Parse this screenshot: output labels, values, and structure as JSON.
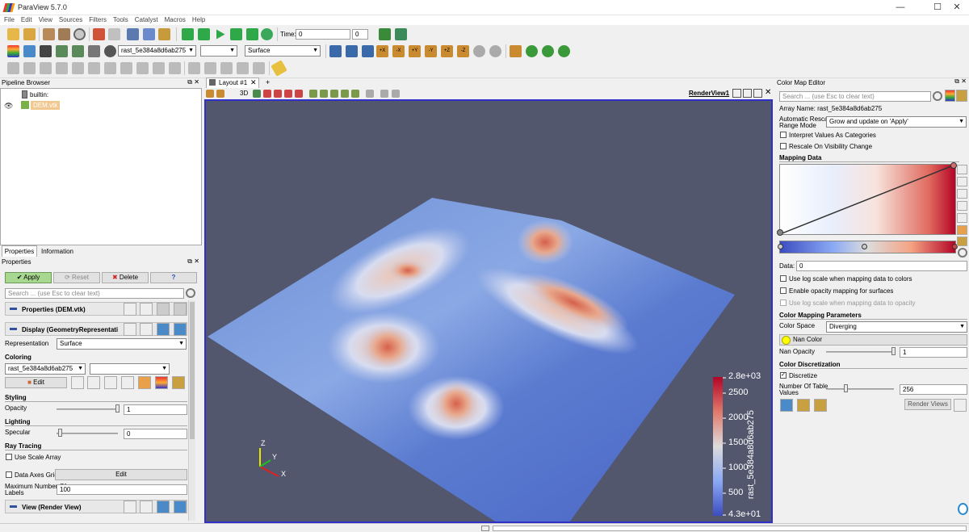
{
  "window": {
    "title": "ParaView 5.7.0",
    "minimize": "—",
    "maximize": "☐",
    "close": "✕"
  },
  "menu": [
    "File",
    "Edit",
    "View",
    "Sources",
    "Filters",
    "Tools",
    "Catalyst",
    "Macros",
    "Help"
  ],
  "toolbar": {
    "time_label": "Time:",
    "time_value": "0",
    "time_step": "0",
    "active_array": "rast_5e384a8d6ab275",
    "representation": "Surface",
    "camera_buttons": [
      "+X",
      "-X",
      "+Y",
      "-Y",
      "+Z",
      "-Z"
    ]
  },
  "pipeline_browser": {
    "title": "Pipeline Browser",
    "items": [
      "builtin:",
      "DEM.vtk"
    ]
  },
  "layout_tabs": {
    "tab": "Layout #1",
    "add": "+",
    "render_view": "RenderView1",
    "mode_3d": "3D"
  },
  "properties": {
    "tabs": [
      "Properties",
      "Information"
    ],
    "title": "Properties",
    "apply": "Apply",
    "reset": "Reset",
    "delete": "Delete",
    "help": "?",
    "search_placeholder": "Search ... (use Esc to clear text)",
    "sections": {
      "properties": "Properties (DEM.vtk)",
      "display": "Display (GeometryRepresentati",
      "view": "View (Render View)"
    },
    "representation_label": "Representation",
    "representation_value": "Surface",
    "coloring_header": "Coloring",
    "coloring_array": "rast_5e384a8d6ab275",
    "edit": "Edit",
    "styling_header": "Styling",
    "opacity_label": "Opacity",
    "opacity_value": "1",
    "lighting_header": "Lighting",
    "specular_label": "Specular",
    "specular_value": "0",
    "ray_tracing_header": "Ray Tracing",
    "use_scale_array": "Use Scale Array",
    "data_axes_grid": "Data Axes Grid",
    "data_axes_edit": "Edit",
    "max_labels_label_1": "Maximum Number Of",
    "max_labels_label_2": "Labels",
    "max_labels_value": "100"
  },
  "colorbar": {
    "title": "rast_5e384a8d6ab275",
    "labels": [
      "2.8e+03",
      "2500",
      "2000",
      "1500",
      "1000",
      "500",
      "4.3e+01"
    ]
  },
  "axes": {
    "x": "X",
    "y": "Y",
    "z": "Z"
  },
  "color_map_editor": {
    "title": "Color Map Editor",
    "search_placeholder": "Search ... (use Esc to clear text)",
    "array_name": "Array Name: rast_5e384a8d6ab275",
    "auto_rescale_label_1": "Automatic Rescale",
    "auto_rescale_label_2": "Range Mode",
    "auto_rescale_value": "Grow and update on 'Apply'",
    "interpret_categories": "Interpret Values As Categories",
    "rescale_visibility": "Rescale On Visibility Change",
    "mapping_data_header": "Mapping Data",
    "data_label": "Data:",
    "data_value": "0",
    "use_log_scale": "Use log scale when mapping data to colors",
    "enable_opacity": "Enable opacity mapping for surfaces",
    "use_log_opacity": "Use log scale when mapping data to opacity",
    "mapping_params_header": "Color Mapping Parameters",
    "color_space_label": "Color Space",
    "color_space_value": "Diverging",
    "nan_color": "Nan Color",
    "nan_opacity_label": "Nan Opacity",
    "nan_opacity_value": "1",
    "discretization_header": "Color Discretization",
    "discretize": "Discretize",
    "table_values_label_1": "Number Of Table",
    "table_values_label_2": "Values",
    "table_values_value": "256",
    "render_views": "Render Views"
  },
  "colors": {
    "accent_blue": "#3b4cc0",
    "accent_red": "#b40426",
    "view_bg": "#52576e",
    "apply_green": "#a8d890"
  }
}
